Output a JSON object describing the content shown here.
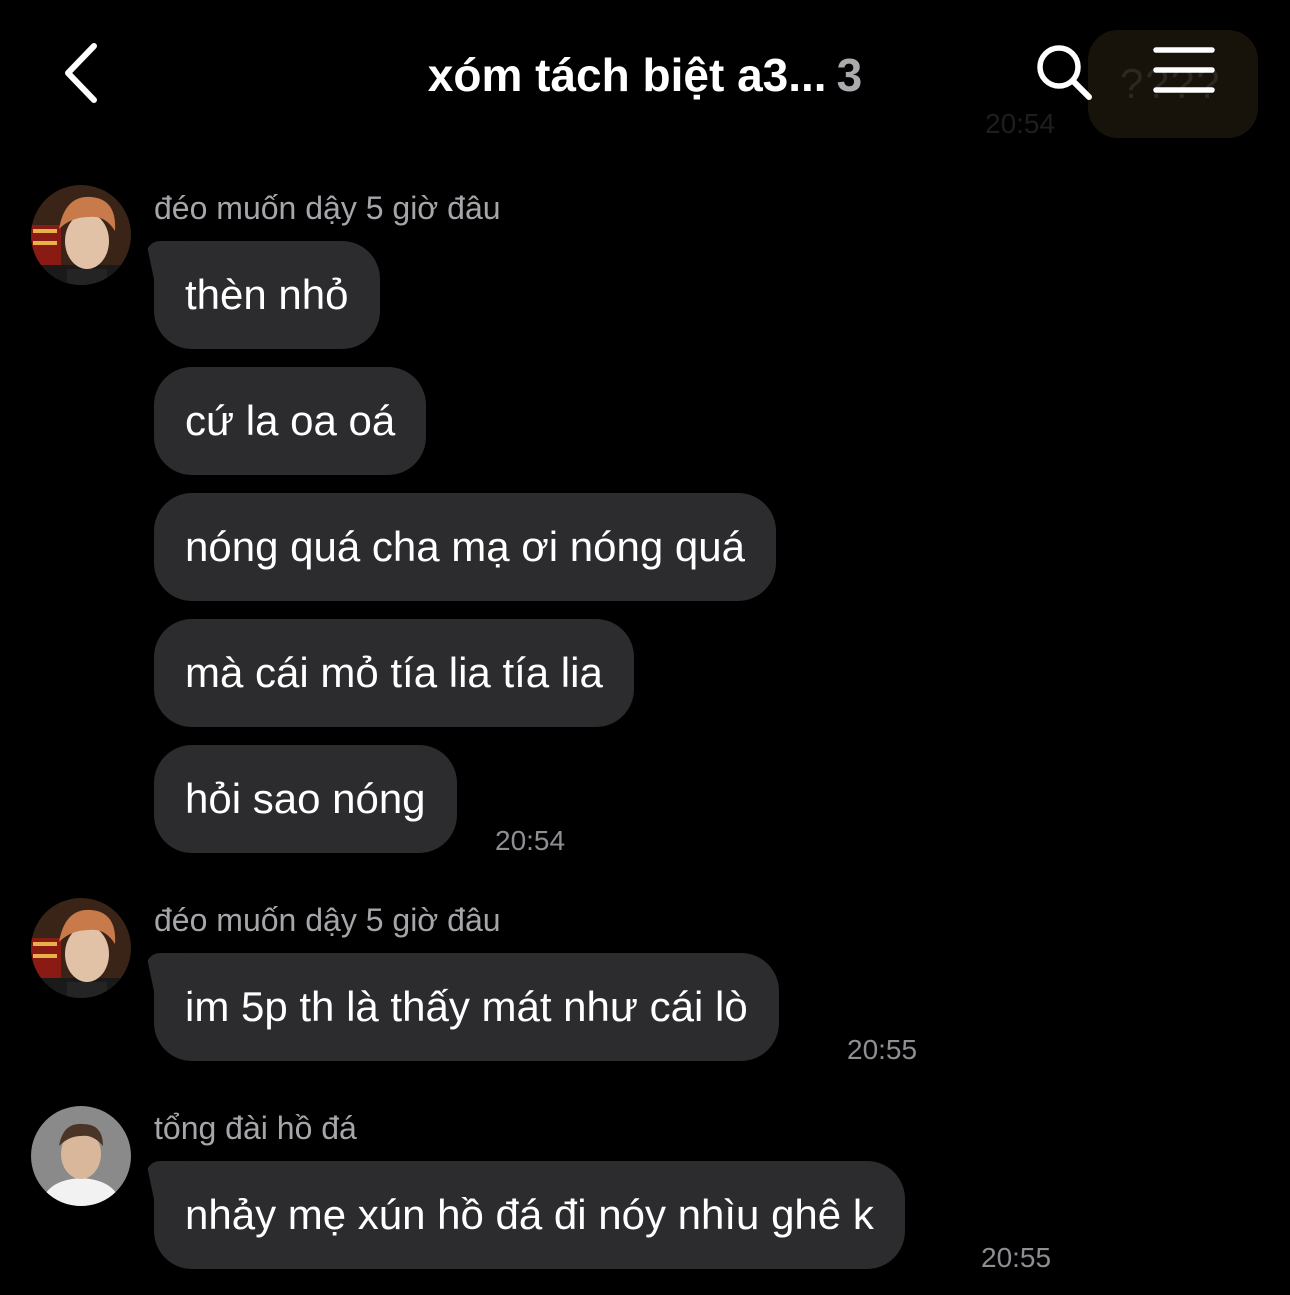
{
  "header": {
    "title": "xóm tách biệt a3...",
    "member_count": "3"
  },
  "background_message": {
    "text": "????",
    "time": "20:54"
  },
  "groups": [
    {
      "sender": "đéo muốn dậy 5 giờ đâu",
      "avatar": "avatar-boy-orange-hair",
      "messages": [
        "thèn nhỏ",
        "cứ la oa oá",
        "nóng quá cha mạ ơi nóng quá",
        "mà cái mỏ tía lia tía lia",
        "hỏi sao nóng"
      ],
      "time": "20:54"
    },
    {
      "sender": "đéo muốn dậy 5 giờ đâu",
      "avatar": "avatar-boy-orange-hair",
      "messages": [
        "im 5p th là thấy mát như cái lò"
      ],
      "time": "20:55"
    },
    {
      "sender": "tổng đài hồ đá",
      "avatar": "avatar-boy-white-shirt",
      "messages": [
        "nhảy mẹ xún hồ đá đi nóy nhìu ghê k"
      ],
      "time": "20:55"
    }
  ],
  "colors": {
    "background": "#000000",
    "bubble": "#2c2c2e",
    "secondary_text": "#a5a5aa",
    "timestamp": "#8e8e93"
  }
}
